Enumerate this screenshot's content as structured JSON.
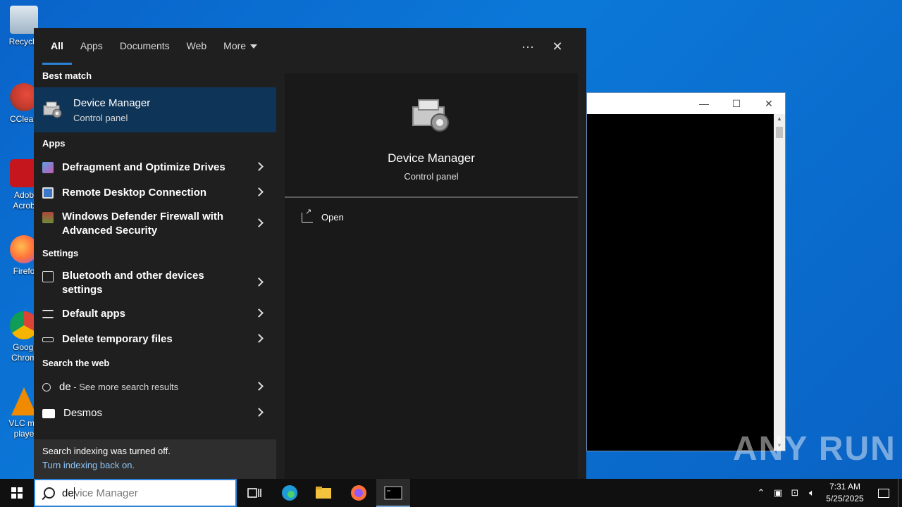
{
  "desktop": {
    "icons": [
      {
        "label": "Recycle",
        "name": "recycle-bin"
      },
      {
        "label": "CClean",
        "name": "ccleaner"
      },
      {
        "label": "Adob Acrob",
        "name": "adobe-acrobat"
      },
      {
        "label": "Firefo",
        "name": "firefox"
      },
      {
        "label": "Googl Chrom",
        "name": "google-chrome"
      },
      {
        "label": "VLC me playe",
        "name": "vlc-media-player"
      }
    ],
    "watermark": "ANY RUN"
  },
  "console_window": {
    "minimize": "—",
    "maximize": "☐",
    "close": "✕"
  },
  "search": {
    "tabs": [
      {
        "label": "All",
        "active": true
      },
      {
        "label": "Apps",
        "active": false
      },
      {
        "label": "Documents",
        "active": false
      },
      {
        "label": "Web",
        "active": false
      },
      {
        "label": "More",
        "active": false
      }
    ],
    "options_glyph": "···",
    "close_glyph": "✕",
    "best_match": {
      "section": "Best match",
      "title": "Device Manager",
      "subtitle": "Control panel"
    },
    "apps": {
      "section": "Apps",
      "items": [
        "Defragment and Optimize Drives",
        "Remote Desktop Connection",
        "Windows Defender Firewall with Advanced Security"
      ]
    },
    "settings": {
      "section": "Settings",
      "items": [
        "Bluetooth and other devices settings",
        "Default apps",
        "Delete temporary files"
      ]
    },
    "web": {
      "section": "Search the web",
      "query": "de",
      "query_hint": " - See more search results",
      "items": [
        "Desmos"
      ]
    },
    "indexing": {
      "message": "Search indexing was turned off.",
      "link": "Turn indexing back on."
    },
    "preview": {
      "title": "Device Manager",
      "subtitle": "Control panel",
      "open_label": "Open"
    }
  },
  "taskbar": {
    "search_typed": "de",
    "search_ghost": "vice Manager",
    "tray": {
      "time": "7:31 AM",
      "date": "5/25/2025"
    }
  },
  "colors": {
    "accent": "#2a83d8",
    "best_match_bg": "#0e3558",
    "panel_bg": "#1f1f1f",
    "link": "#8ec4f5"
  }
}
